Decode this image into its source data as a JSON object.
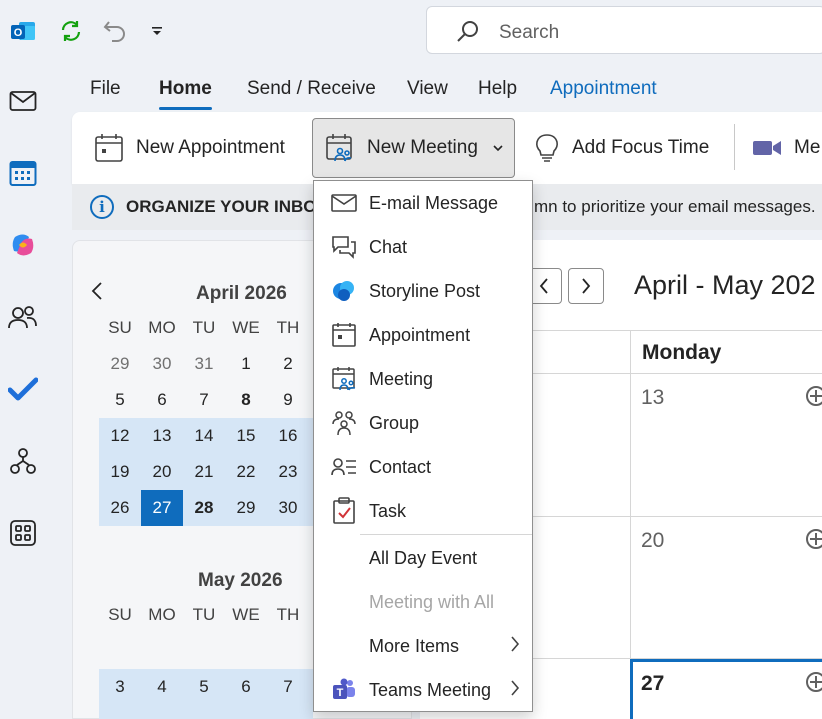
{
  "quick_access": {
    "app_icon": "outlook-icon",
    "sync_icon": "sync-icon",
    "undo_icon": "undo-icon",
    "customize_icon": "customize-toolbar-icon"
  },
  "search": {
    "placeholder": "Search"
  },
  "tabs": [
    {
      "label": "File"
    },
    {
      "label": "Home",
      "active": true
    },
    {
      "label": "Send / Receive"
    },
    {
      "label": "View"
    },
    {
      "label": "Help"
    },
    {
      "label": "Appointment",
      "accent": true
    }
  ],
  "ribbon": {
    "new_appointment": "New Appointment",
    "new_meeting": "New Meeting",
    "add_focus_time": "Add Focus Time",
    "meet_now_partial": "Me"
  },
  "infobar": {
    "title": "ORGANIZE YOUR INBO",
    "text": "mn to prioritize your email messages."
  },
  "rail": [
    "mail-icon",
    "calendar-icon",
    "copilot-icon",
    "people-icon",
    "todo-icon",
    "org-explorer-icon",
    "apps-icon"
  ],
  "mini_calendar": {
    "april": {
      "title": "April 2026",
      "weekdays": [
        "SU",
        "MO",
        "TU",
        "WE",
        "TH"
      ],
      "weeks": [
        [
          "29",
          "30",
          "31",
          "1",
          "2"
        ],
        [
          "5",
          "6",
          "7",
          "8",
          "9"
        ],
        [
          "12",
          "13",
          "14",
          "15",
          "16"
        ],
        [
          "19",
          "20",
          "21",
          "22",
          "23"
        ],
        [
          "26",
          "27",
          "28",
          "29",
          "30"
        ]
      ]
    },
    "may": {
      "title": "May 2026",
      "weekdays": [
        "SU",
        "MO",
        "TU",
        "WE",
        "TH"
      ],
      "weeks": [
        [
          "3",
          "4",
          "5",
          "6",
          "7"
        ]
      ]
    }
  },
  "calendar_view": {
    "range_title": "April - May 202",
    "column_header": "Monday",
    "dates": [
      "13",
      "20",
      "27"
    ]
  },
  "dropdown": {
    "items": [
      {
        "label": "E-mail Message",
        "icon": "envelope-icon"
      },
      {
        "label": "Chat",
        "icon": "chat-icon"
      },
      {
        "label": "Storyline Post",
        "icon": "storyline-icon"
      },
      {
        "label": "Appointment",
        "icon": "appointment-icon"
      },
      {
        "label": "Meeting",
        "icon": "meeting-icon"
      },
      {
        "label": "Group",
        "icon": "group-icon"
      },
      {
        "label": "Contact",
        "icon": "contact-icon"
      },
      {
        "label": "Task",
        "icon": "task-icon"
      },
      {
        "label": "All Day Event"
      },
      {
        "label": "Meeting with All",
        "disabled": true
      },
      {
        "label": "More Items",
        "submenu": true
      },
      {
        "label": "Teams Meeting",
        "icon": "teams-icon",
        "submenu": true
      }
    ]
  },
  "colors": {
    "accent": "#0f6cbd",
    "week_highlight": "#d6e6f6",
    "today": "#0f6cbd"
  }
}
